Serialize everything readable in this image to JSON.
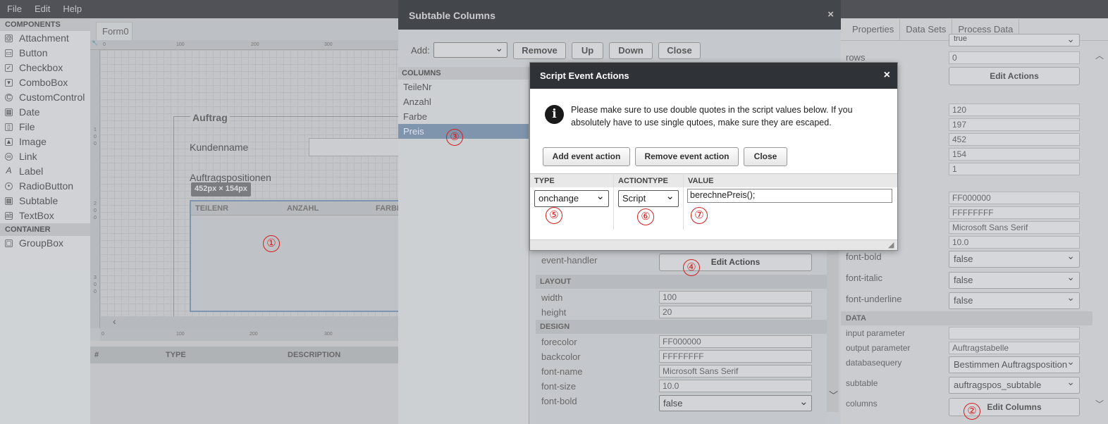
{
  "menu": [
    "File",
    "Edit",
    "Help"
  ],
  "components": {
    "header": "COMPONENTS",
    "items": [
      "Attachment",
      "Button",
      "Checkbox",
      "ComboBox",
      "CustomControl",
      "Date",
      "File",
      "Image",
      "Link",
      "Label",
      "RadioButton",
      "Subtable",
      "TextBox"
    ],
    "container_header": "CONTAINER",
    "container_items": [
      "GroupBox"
    ]
  },
  "canvas": {
    "tab": "Form0",
    "ruler_top": [
      "0",
      "100",
      "200",
      "300"
    ],
    "ruler_bottom": [
      "0",
      "100",
      "200",
      "300"
    ],
    "ruler_left": [
      "1",
      "0",
      "0",
      "2",
      "0",
      "0",
      "3",
      "0",
      "0"
    ],
    "group_label": "Auftrag",
    "kundenname": "Kundenname",
    "auftragspositionen": "Auftragspositionen",
    "size_badge": "452px × 154px",
    "table_headers": [
      "TEILENR",
      "ANZAHL",
      "FARBI"
    ]
  },
  "bottom_table": {
    "headers": [
      "#",
      "TYPE",
      "DESCRIPTION"
    ]
  },
  "right_panel": {
    "tabs": [
      "Properties",
      "Data Sets",
      "Process Data"
    ],
    "top_select": "true",
    "rows_label": "rows",
    "rows_value": "0",
    "edit_actions": "Edit Actions",
    "values": [
      "120",
      "197",
      "452",
      "154",
      "1"
    ],
    "design_values": [
      "FF000000",
      "FFFFFFFF",
      "Microsoft Sans Serif",
      "10.0"
    ],
    "font_bold_label": "font-bold",
    "font_bold": "false",
    "font_italic_label": "font-italic",
    "font_italic": "false",
    "font_underline_label": "font-underline",
    "font_underline": "false",
    "data_header": "DATA",
    "input_param_label": "input parameter",
    "input_param": "",
    "output_param_label": "output parameter",
    "output_param": "Auftragstabelle",
    "dbquery_label": "databasequery",
    "dbquery": "Bestimmen Auftragsposition",
    "subtable_label": "subtable",
    "subtable": "auftragspos_subtable",
    "columns_label": "columns",
    "edit_columns": "Edit Columns"
  },
  "subtable_dialog": {
    "title": "Subtable Columns",
    "close_x": "×",
    "add_label": "Add:",
    "buttons": [
      "Remove",
      "Up",
      "Down",
      "Close"
    ],
    "columns_header": "COLUMNS",
    "columns": [
      "TeileNr",
      "Anzahl",
      "Farbe",
      "Preis"
    ],
    "event_handler_label": "event-handler",
    "edit_actions": "Edit Actions",
    "layout_header": "LAYOUT",
    "width_label": "width",
    "width": "100",
    "height_label": "height",
    "height": "20",
    "design_header": "DESIGN",
    "forecolor_label": "forecolor",
    "forecolor": "FF000000",
    "backcolor_label": "backcolor",
    "backcolor": "FFFFFFFF",
    "fontname_label": "font-name",
    "fontname": "Microsoft Sans Serif",
    "fontsize_label": "font-size",
    "fontsize": "10.0",
    "fontbold_label": "font-bold",
    "fontbold": "false"
  },
  "script_dialog": {
    "title": "Script Event Actions",
    "close_x": "×",
    "info": "Please make sure to use double quotes in the script values below. If you absolutely have to use single qutoes, make sure they are escaped.",
    "add_button": "Add event action",
    "remove_button": "Remove event action",
    "close_button": "Close",
    "headers": [
      "TYPE",
      "ACTIONTYPE",
      "VALUE"
    ],
    "type": "onchange",
    "actiontype": "Script",
    "value": "berechnePreis();"
  },
  "markers": [
    "①",
    "②",
    "③",
    "④",
    "⑤",
    "⑥",
    "⑦"
  ],
  "colors": {
    "marker": "#d42020",
    "dialog_title": "#2f3236",
    "selected_column": "#7f99b3"
  }
}
